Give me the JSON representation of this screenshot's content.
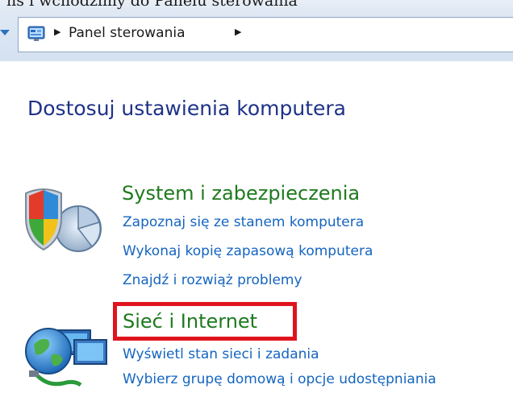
{
  "top_strip": {
    "text": "ns i wchodzimy do Panelu sterowania"
  },
  "address_bar": {
    "icon": "control-panel-icon",
    "crumb": "Panel sterowania"
  },
  "page_title": "Dostosuj ustawienia komputera",
  "categories": [
    {
      "icon": "shield-security-icon",
      "title": "System i zabezpieczenia",
      "links": [
        "Zapoznaj się ze stanem komputera",
        "Wykonaj kopię zapasową komputera",
        "Znajdź i rozwiąż problemy"
      ]
    },
    {
      "icon": "network-globe-icon",
      "title": "Sieć i Internet",
      "links": [
        "Wyświetl stan sieci i zadania",
        "Wybierz grupę domową i opcje udostępniania"
      ]
    }
  ],
  "annotation": {
    "highlight_color": "#e0141e"
  },
  "colors": {
    "category_title": "#1e7a1e",
    "link": "#1565c0",
    "page_title": "#1e3287"
  }
}
